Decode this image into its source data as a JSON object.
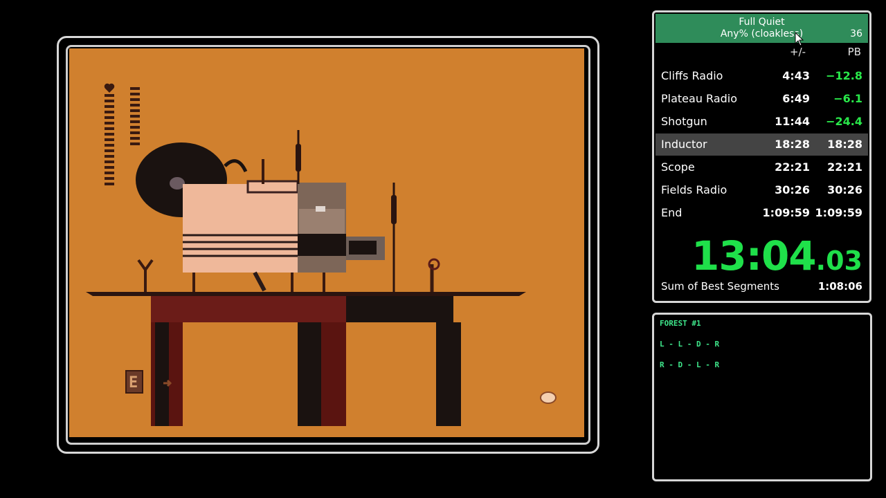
{
  "splits": {
    "title": "Full Quiet",
    "category": "Any% (cloakless)",
    "attempts": "36",
    "col_delta": "+/-",
    "col_pb": "PB",
    "rows": [
      {
        "name": "Cliffs Radio",
        "delta": "4:43",
        "time": "−12.8",
        "time_style": "ahead"
      },
      {
        "name": "Plateau Radio",
        "delta": "6:49",
        "time": "−6.1",
        "time_style": "ahead"
      },
      {
        "name": "Shotgun",
        "delta": "11:44",
        "time": "−24.4",
        "time_style": "ahead"
      },
      {
        "name": "Inductor",
        "delta": "18:28",
        "time": "18:28",
        "time_style": "neutral"
      },
      {
        "name": "Scope",
        "delta": "22:21",
        "time": "22:21",
        "time_style": "neutral"
      },
      {
        "name": "Fields Radio",
        "delta": "30:26",
        "time": "30:26",
        "time_style": "neutral"
      },
      {
        "name": "End",
        "delta": "1:09:59",
        "time": "1:09:59",
        "time_style": "neutral"
      }
    ],
    "current_index": 3,
    "timer_main": "13:04",
    "timer_frac": ".03",
    "sob_label": "Sum of Best Segments",
    "sob_value": "1:08:06"
  },
  "notes": {
    "lines": [
      "FOREST #1",
      "L - L - D - R",
      "R - D - L - R"
    ]
  },
  "game": {
    "letter": "E"
  },
  "colors": {
    "header_green": "#2f8c5a",
    "ahead_green": "#29e84a",
    "timer_green": "#1fe04a",
    "note_green": "#3ee58a",
    "game_bg": "#d0802e",
    "current_row": "#444444"
  }
}
